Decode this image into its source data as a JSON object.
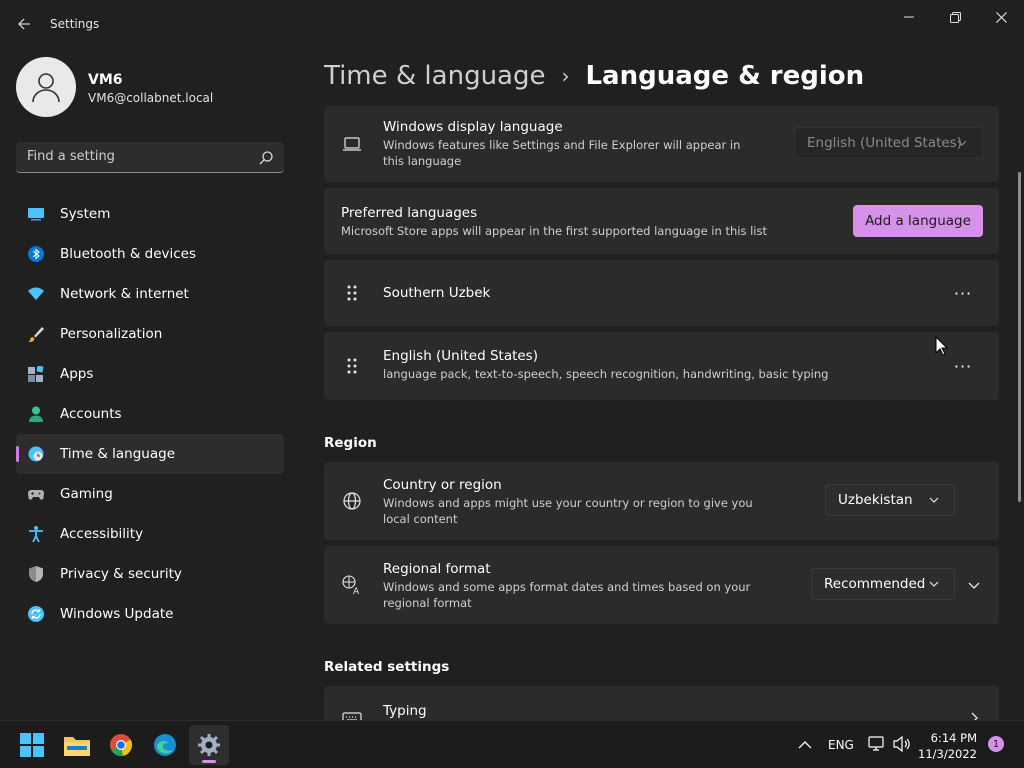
{
  "window": {
    "title": "Settings",
    "controls": [
      "minimize-icon",
      "restore-icon",
      "close-icon"
    ]
  },
  "profile": {
    "name": "VM6",
    "email": "VM6@collabnet.local"
  },
  "search": {
    "placeholder": "Find a setting"
  },
  "sidebar": {
    "items": [
      {
        "label": "System",
        "icon": "monitor-icon",
        "color": "#4cc2ff"
      },
      {
        "label": "Bluetooth & devices",
        "icon": "bluetooth-icon",
        "color": "#0078d4"
      },
      {
        "label": "Network & internet",
        "icon": "wifi-icon",
        "color": "#4cc2ff"
      },
      {
        "label": "Personalization",
        "icon": "brush-icon",
        "color": "#f2a33a"
      },
      {
        "label": "Apps",
        "icon": "apps-icon",
        "color": "#9fb3c8"
      },
      {
        "label": "Accounts",
        "icon": "person-icon",
        "color": "#3bc48a"
      },
      {
        "label": "Time & language",
        "icon": "globe-clock-icon",
        "color": "#4cc2ff",
        "active": true
      },
      {
        "label": "Gaming",
        "icon": "gamepad-icon",
        "color": "#b0b0b0"
      },
      {
        "label": "Accessibility",
        "icon": "accessibility-icon",
        "color": "#4cc2ff"
      },
      {
        "label": "Privacy & security",
        "icon": "shield-icon",
        "color": "#8c8c8c"
      },
      {
        "label": "Windows Update",
        "icon": "update-icon",
        "color": "#4cc2ff"
      }
    ]
  },
  "header": {
    "parent": "Time & language",
    "separator": "›",
    "current": "Language & region"
  },
  "display_language": {
    "title": "Windows display language",
    "description": "Windows features like Settings and File Explorer will appear in this language",
    "value": "English (United States)"
  },
  "preferred_languages": {
    "title": "Preferred languages",
    "description": "Microsoft Store apps will appear in the first supported language in this list",
    "add_button": "Add a language",
    "languages": [
      {
        "name": "Southern Uzbek",
        "features": ""
      },
      {
        "name": "English (United States)",
        "features": "language pack, text-to-speech, speech recognition, handwriting, basic typing"
      }
    ],
    "more_label": "···"
  },
  "region": {
    "section_title": "Region",
    "country": {
      "title": "Country or region",
      "description": "Windows and apps might use your country or region to give you local content",
      "value": "Uzbekistan"
    },
    "format": {
      "title": "Regional format",
      "description": "Windows and some apps format dates and times based on your regional format",
      "value": "Recommended"
    }
  },
  "related": {
    "section_title": "Related settings",
    "typing": {
      "title": "Typing"
    }
  },
  "taskbar": {
    "apps": [
      "start-icon",
      "file-explorer-icon",
      "chrome-icon",
      "edge-icon",
      "settings-icon"
    ],
    "language": "ENG",
    "time": "6:14 PM",
    "date": "11/3/2022",
    "notifications": "1",
    "accent": "#d592e8"
  }
}
